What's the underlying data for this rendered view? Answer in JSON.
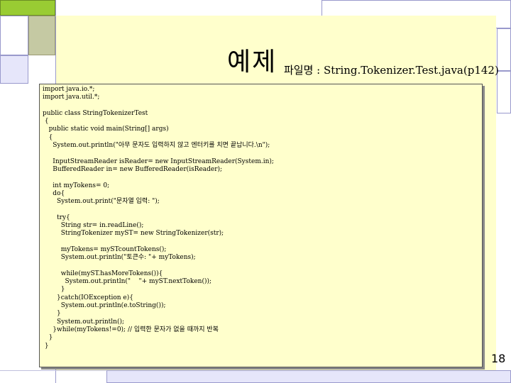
{
  "slide": {
    "title": "예제",
    "subtitle": "파일명 : String.Tokenizer.Test.java(p142)",
    "page_number": "18"
  },
  "code_lines": [
    "import java.io.*;",
    "import java.util.*;",
    "",
    "public class StringTokenizerTest",
    " {",
    "   public static void main(String[] args)",
    "   {",
    "     System.out.println(\"아무 문자도 입력하지 않고 엔터키를 치면 끝납니다.\\n\");",
    "",
    "     InputStreamReader isReader= new InputStreamReader(System.in);",
    "     BufferedReader in= new BufferedReader(isReader);",
    "",
    "     int myTokens= 0;",
    "     do{",
    "       System.out.print(\"문자열 입력: \");",
    "",
    "       try{",
    "         String str= in.readLine();",
    "         StringTokenizer myST= new StringTokenizer(str);",
    "",
    "         myTokens= mySTcountTokens();",
    "         System.out.println(\"토큰수: \"+ myTokens);",
    "",
    "         while(myST.hasMoreTokens()){",
    "           System.out.println(\"    \"+ myST.nextToken());",
    "         }",
    "       }catch(IOException e){",
    "         System.out.println(e.toString());",
    "       }",
    "       System.out.println();",
    "     }while(myTokens!=0); // 입력한 문자가 없을 때까지 반복",
    "   }",
    " }"
  ]
}
